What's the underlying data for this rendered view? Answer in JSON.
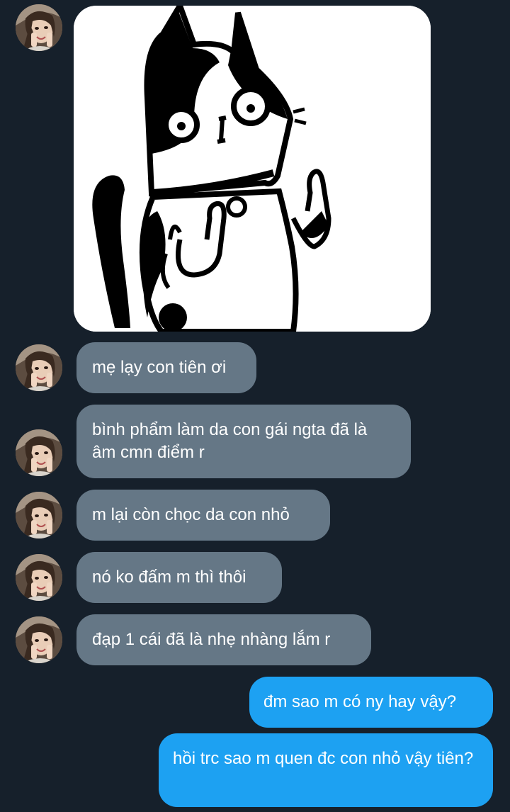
{
  "conversation": {
    "sticker": {
      "icon": "cat-middle-finger-sticker"
    },
    "incoming": [
      {
        "text": "mẹ lạy con tiên ơi"
      },
      {
        "text": "bình phẩm làm da con gái ngta đã là âm cmn điểm r"
      },
      {
        "text": "m lại còn chọc da con nhỏ"
      },
      {
        "text": "nó ko đấm m thì thôi"
      },
      {
        "text": "đạp 1 cái đã là nhẹ nhàng lắm r"
      }
    ],
    "outgoing": [
      {
        "text": "đm sao m có ny hay vậy?"
      },
      {
        "text": "hồi trc sao m quen đc con nhỏ vậy tiên?"
      }
    ]
  },
  "colors": {
    "background": "#16202b",
    "incoming_bubble": "#657786",
    "outgoing_bubble": "#1da1f2"
  }
}
